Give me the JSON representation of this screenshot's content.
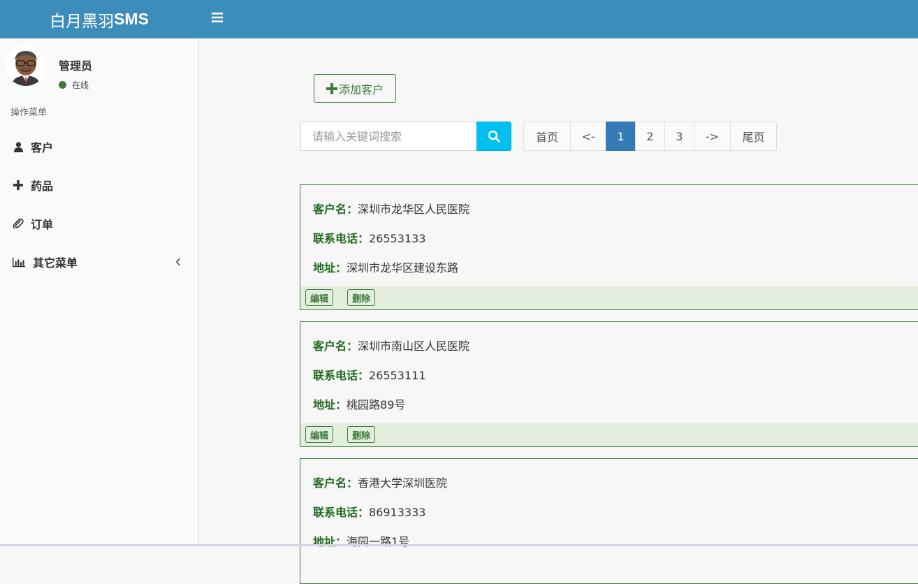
{
  "header": {
    "brand_prefix": "白月黑羽",
    "brand_suffix": "SMS",
    "accent_color": "#3c8dbc"
  },
  "user": {
    "name": "管理员",
    "status": "在线",
    "status_color": "#3d7b3a"
  },
  "sidebar": {
    "menu_header": "操作菜单",
    "items": [
      {
        "label": "客户",
        "icon": "user-icon"
      },
      {
        "label": "药品",
        "icon": "plus-icon"
      },
      {
        "label": "订单",
        "icon": "paperclip-icon"
      },
      {
        "label": "其它菜单",
        "icon": "bar-chart-icon",
        "has_submenu": true
      }
    ]
  },
  "toolbar": {
    "add_label": "添加客户"
  },
  "search": {
    "placeholder": "请输入关键词搜索",
    "value": ""
  },
  "pagination": {
    "first": "首页",
    "prev": "<-",
    "pages": [
      "1",
      "2",
      "3"
    ],
    "current": "1",
    "next": "->",
    "last": "尾页",
    "active_color": "#337ab7"
  },
  "labels": {
    "name": "客户名：",
    "phone": "联系电话：",
    "address": "地址：",
    "edit": "编辑",
    "delete": "删除"
  },
  "customers": [
    {
      "name": "深圳市龙华区人民医院",
      "phone": "26553133",
      "address": "深圳市龙华区建设东路"
    },
    {
      "name": "深圳市南山区人民医院",
      "phone": "26553111",
      "address": "桃园路89号"
    },
    {
      "name": "香港大学深圳医院",
      "phone": "86913333",
      "address": "海园一路1号"
    }
  ]
}
